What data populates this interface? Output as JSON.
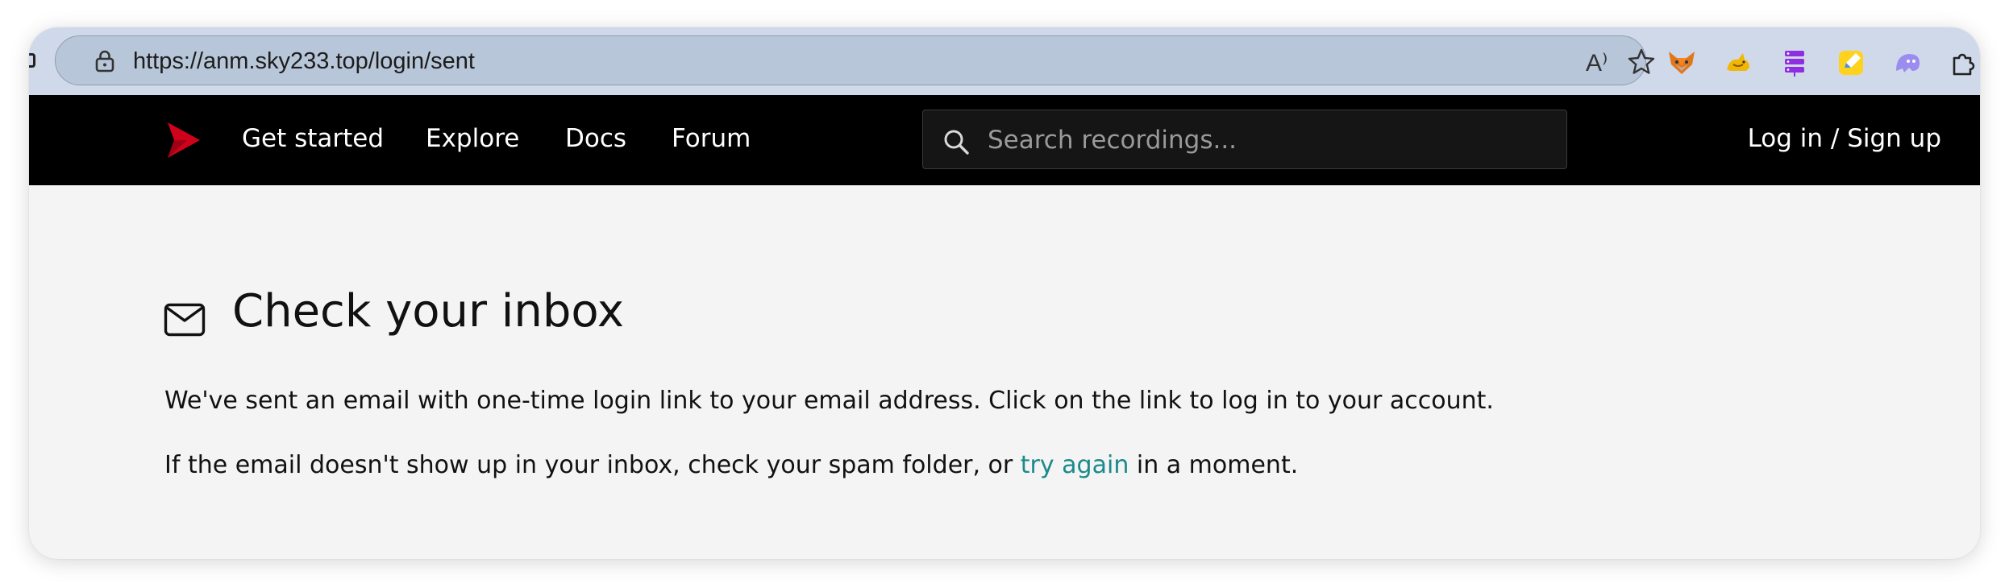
{
  "browser": {
    "url": "https://anm.sky233.top/login/sent",
    "read_aloud_label": "A⁾",
    "extensions": [
      "fox-extension-icon",
      "cat-extension-icon",
      "server-extension-icon",
      "note-extension-icon",
      "ghost-extension-icon",
      "puzzle-extension-icon"
    ]
  },
  "nav": {
    "items": [
      {
        "label": "Get started"
      },
      {
        "label": "Explore"
      },
      {
        "label": "Docs"
      },
      {
        "label": "Forum"
      }
    ],
    "search_placeholder": "Search recordings...",
    "login_label": "Log in / Sign up"
  },
  "main": {
    "title": "Check your inbox",
    "paragraph1": "We've sent an email with one-time login link to your email address. Click on the link to log in to your account.",
    "paragraph2_before": "If the email doesn't show up in your inbox, check your spam folder, or ",
    "paragraph2_link": "try again",
    "paragraph2_after": " in a moment."
  },
  "colors": {
    "brand": "#d0021b",
    "link": "#1b8a8a",
    "nav_bg": "#000000",
    "page_bg": "#f4f4f4"
  }
}
